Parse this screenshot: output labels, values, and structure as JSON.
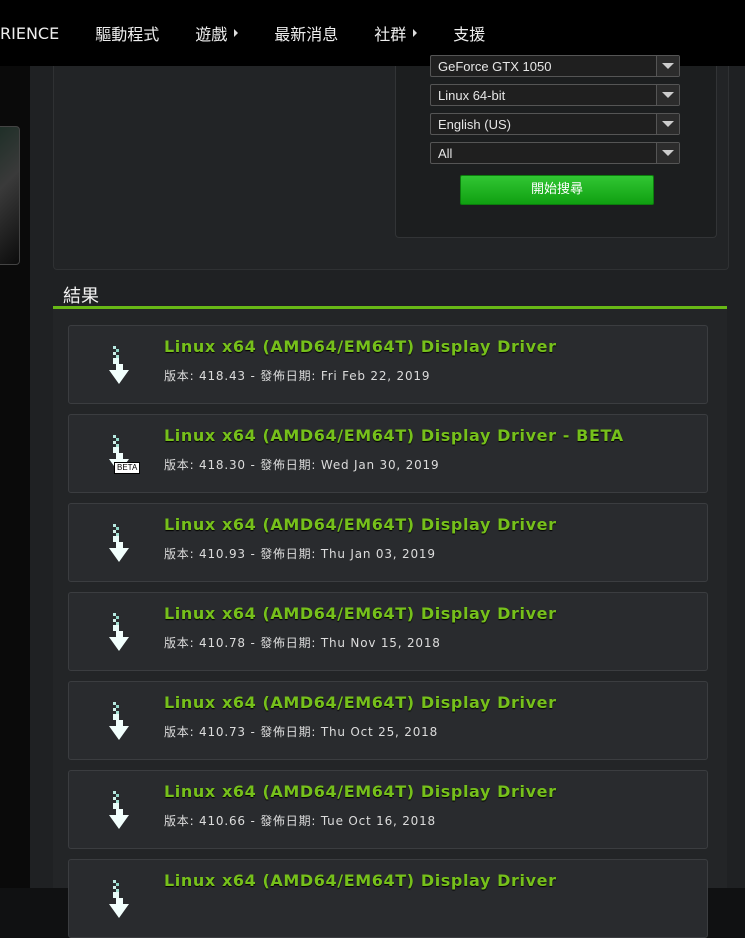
{
  "nav": {
    "items": [
      {
        "label": "RIENCE",
        "has_caret": false
      },
      {
        "label": "驅動程式",
        "has_caret": false
      },
      {
        "label": "遊戲",
        "has_caret": true
      },
      {
        "label": "最新消息",
        "has_caret": false
      },
      {
        "label": "社群",
        "has_caret": true
      },
      {
        "label": "支援",
        "has_caret": false
      }
    ]
  },
  "search": {
    "selects": [
      "GeForce GTX 1050",
      "Linux 64-bit",
      "English (US)",
      "All"
    ],
    "button_label": "開始搜尋"
  },
  "results": {
    "title": "結果",
    "items": [
      {
        "title": "Linux x64 (AMD64/EM64T) Display Driver",
        "meta": "版本: 418.43 - 發佈日期: Fri Feb 22, 2019",
        "beta": false
      },
      {
        "title": "Linux x64 (AMD64/EM64T) Display Driver - BETA",
        "meta": "版本: 418.30 - 發佈日期: Wed Jan 30, 2019",
        "beta": true,
        "badge": "BETA"
      },
      {
        "title": "Linux x64 (AMD64/EM64T) Display Driver",
        "meta": "版本: 410.93 - 發佈日期: Thu Jan 03, 2019",
        "beta": false
      },
      {
        "title": "Linux x64 (AMD64/EM64T) Display Driver",
        "meta": "版本: 410.78 - 發佈日期: Thu Nov 15, 2018",
        "beta": false
      },
      {
        "title": "Linux x64 (AMD64/EM64T) Display Driver",
        "meta": "版本: 410.73 - 發佈日期: Thu Oct 25, 2018",
        "beta": false
      },
      {
        "title": "Linux x64 (AMD64/EM64T) Display Driver",
        "meta": "版本: 410.66 - 發佈日期: Tue Oct 16, 2018",
        "beta": false
      },
      {
        "title": "Linux x64 (AMD64/EM64T) Display Driver",
        "meta": "",
        "beta": false
      }
    ]
  },
  "colors": {
    "accent_green": "#76c01b",
    "button_green": "#10a011",
    "rule_green": "#68b816"
  }
}
